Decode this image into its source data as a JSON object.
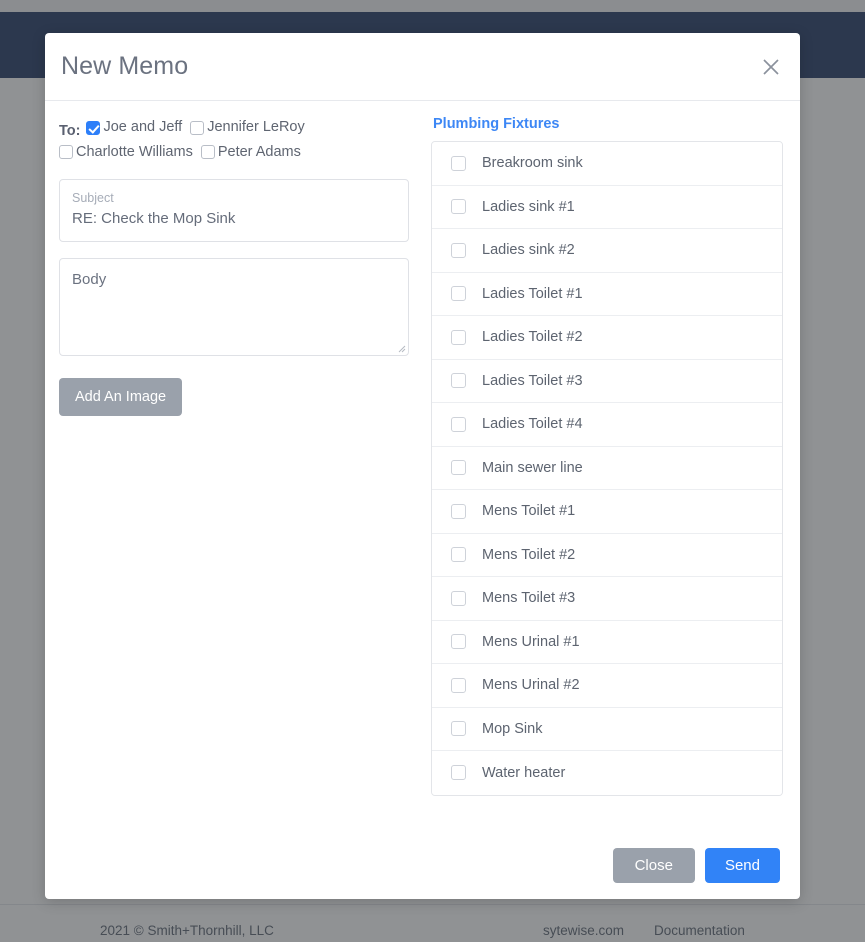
{
  "navbar": {
    "icons": [
      "user-icon",
      "gear-icon",
      "mail-icon"
    ]
  },
  "footer": {
    "copyright": "2021 © Smith+Thornhill, LLC",
    "links": [
      "sytewise.com",
      "Documentation"
    ]
  },
  "modal": {
    "title": "New Memo",
    "close_icon": "close-icon",
    "to": {
      "label": "To:",
      "recipients": [
        {
          "name": "Joe and Jeff",
          "checked": true
        },
        {
          "name": "Jennifer LeRoy",
          "checked": false
        },
        {
          "name": "Charlotte Williams",
          "checked": false
        },
        {
          "name": "Peter Adams",
          "checked": false
        }
      ]
    },
    "subject": {
      "legend": "Subject",
      "value": "RE: Check the Mop Sink"
    },
    "body": {
      "placeholder": "Body",
      "value": ""
    },
    "add_image_label": "Add An Image",
    "fixtures": {
      "heading": "Plumbing Fixtures",
      "items": [
        {
          "name": "Breakroom sink",
          "checked": false
        },
        {
          "name": "Ladies sink #1",
          "checked": false
        },
        {
          "name": "Ladies sink #2",
          "checked": false
        },
        {
          "name": "Ladies Toilet #1",
          "checked": false
        },
        {
          "name": "Ladies Toilet #2",
          "checked": false
        },
        {
          "name": "Ladies Toilet #3",
          "checked": false
        },
        {
          "name": "Ladies Toilet #4",
          "checked": false
        },
        {
          "name": "Main sewer line",
          "checked": false
        },
        {
          "name": "Mens Toilet #1",
          "checked": false
        },
        {
          "name": "Mens Toilet #2",
          "checked": false
        },
        {
          "name": "Mens Toilet #3",
          "checked": false
        },
        {
          "name": "Mens Urinal #1",
          "checked": false
        },
        {
          "name": "Mens Urinal #2",
          "checked": false
        },
        {
          "name": "Mop Sink",
          "checked": false
        },
        {
          "name": "Water heater",
          "checked": false
        }
      ]
    },
    "buttons": {
      "close": "Close",
      "send": "Send"
    }
  },
  "colors": {
    "navbar": "#374b72",
    "accent_blue": "#3183f7",
    "link_blue": "#3d87f5",
    "grey_button": "#9aa1ab",
    "backdrop": "#7c8089"
  }
}
